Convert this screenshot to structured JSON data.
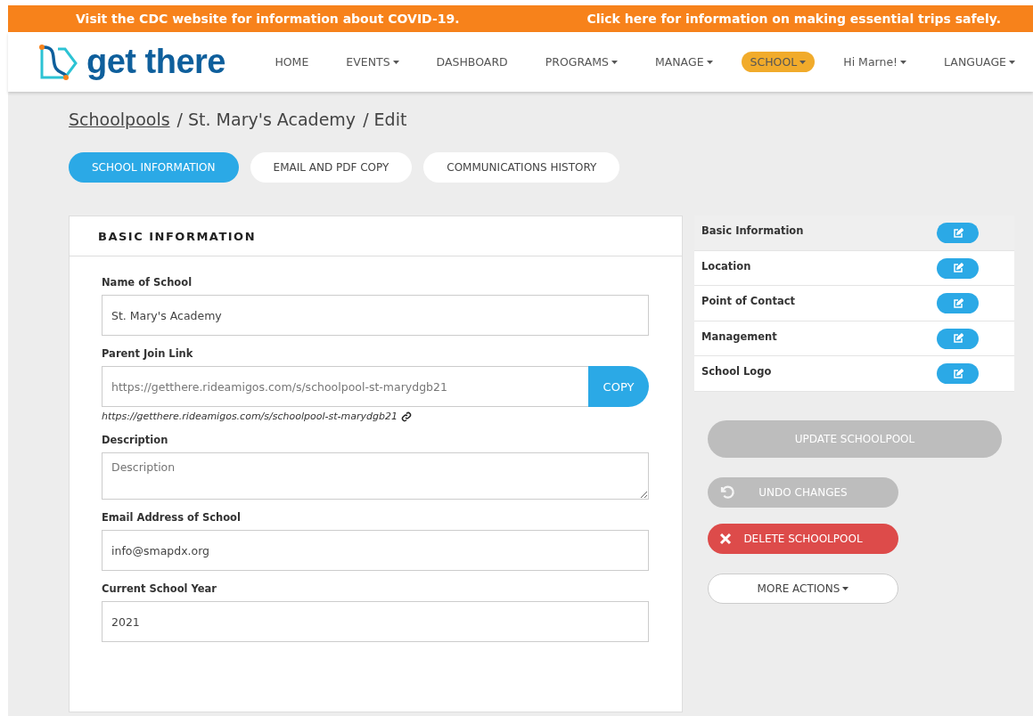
{
  "banner": {
    "left": "Visit the CDC website for information about COVID-19.",
    "right": "Click here for information on making essential trips safely."
  },
  "logo": {
    "text": "get there"
  },
  "nav": [
    {
      "label": "HOME",
      "dropdown": false,
      "selected": false
    },
    {
      "label": "EVENTS",
      "dropdown": true,
      "selected": false
    },
    {
      "label": "DASHBOARD",
      "dropdown": false,
      "selected": false
    },
    {
      "label": "PROGRAMS",
      "dropdown": true,
      "selected": false
    },
    {
      "label": "MANAGE",
      "dropdown": true,
      "selected": false
    },
    {
      "label": "SCHOOL",
      "dropdown": true,
      "selected": true
    },
    {
      "label": "Hi Marne!",
      "dropdown": true,
      "selected": false
    },
    {
      "label": "LANGUAGE",
      "dropdown": true,
      "selected": false
    }
  ],
  "breadcrumb": [
    {
      "label": "Schoolpools",
      "link": true
    },
    {
      "label": "/ St. Mary's Academy",
      "link": false
    },
    {
      "label": "/ Edit",
      "link": false
    }
  ],
  "tabs": [
    {
      "label": "SCHOOL INFORMATION",
      "selected": true
    },
    {
      "label": "EMAIL AND PDF COPY",
      "selected": false
    },
    {
      "label": "COMMUNICATIONS HISTORY",
      "selected": false
    }
  ],
  "form": {
    "title": "BASIC INFORMATION",
    "fields": [
      {
        "kind": "text",
        "label": "Name of School",
        "value": "St. Mary's Academy"
      },
      {
        "kind": "copy",
        "label": "Parent Join Link",
        "value": "https://getthere.rideamigos.com/s/schoolpool-st-marydgb21",
        "button": "COPY",
        "link": "https://getthere.rideamigos.com/s/schoolpool-st-marydgb21"
      },
      {
        "kind": "textarea",
        "label": "Description",
        "placeholder": "Description"
      },
      {
        "kind": "text",
        "label": "Email Address of School",
        "value": "info@smapdx.org"
      },
      {
        "kind": "text",
        "label": "Current School Year",
        "value": "2021"
      }
    ]
  },
  "sections": [
    {
      "label": "Basic Information",
      "selected": true
    },
    {
      "label": "Location",
      "selected": false
    },
    {
      "label": "Point of Contact",
      "selected": false
    },
    {
      "label": "Management",
      "selected": false
    },
    {
      "label": "School Logo",
      "selected": false
    }
  ],
  "actions": [
    {
      "kind": "update",
      "label": "UPDATE SCHOOLPOOL",
      "disabled": true
    },
    {
      "kind": "undo",
      "label": "UNDO CHANGES",
      "disabled": true
    },
    {
      "kind": "delete",
      "label": "DELETE SCHOOLPOOL",
      "disabled": false
    },
    {
      "kind": "more",
      "label": "MORE ACTIONS",
      "disabled": false
    }
  ]
}
